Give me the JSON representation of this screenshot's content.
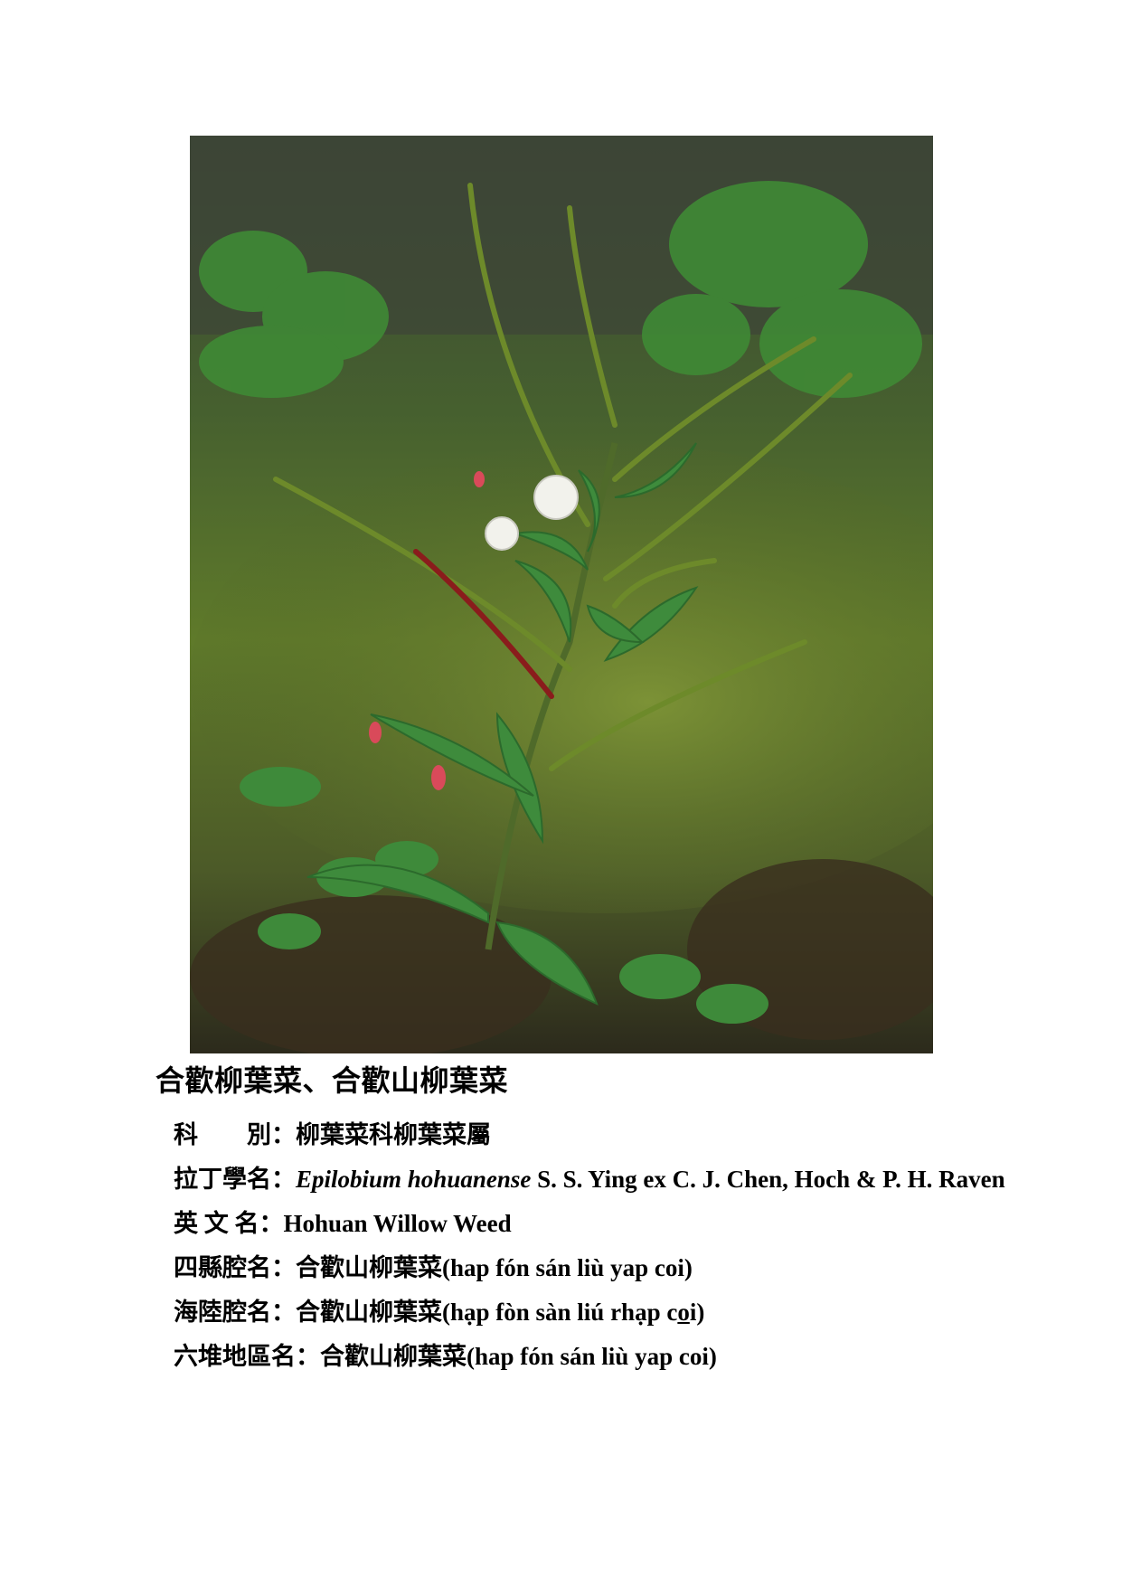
{
  "photo": {
    "subject": "plant-photo"
  },
  "title": "合歡柳葉菜、合歡山柳葉菜",
  "fields": {
    "family": {
      "label": "科　　別：",
      "value": "柳葉菜科柳葉菜屬"
    },
    "latin": {
      "label": "拉丁學名：",
      "genus_species": "Epilobium hohuanense",
      "authority": " S. S. Ying ex C. J. Chen, Hoch & P. H. Raven"
    },
    "english": {
      "label": "英 文 名：",
      "value": "Hohuan Willow Weed"
    },
    "sixian": {
      "label": "四縣腔名：",
      "value": "合歡山柳葉菜",
      "romanization": "(hap fón sán liù yap coi)"
    },
    "hailu": {
      "label": "海陸腔名：",
      "value": "合歡山柳葉菜",
      "romanization_pre": "(hạp fòn sàn liú rhạp c",
      "romanization_under": "o",
      "romanization_post": "i)"
    },
    "liudui": {
      "label": "六堆地區名：",
      "value": "合歡山柳葉菜",
      "romanization": "(hap fón sán liù yap coi)"
    }
  }
}
